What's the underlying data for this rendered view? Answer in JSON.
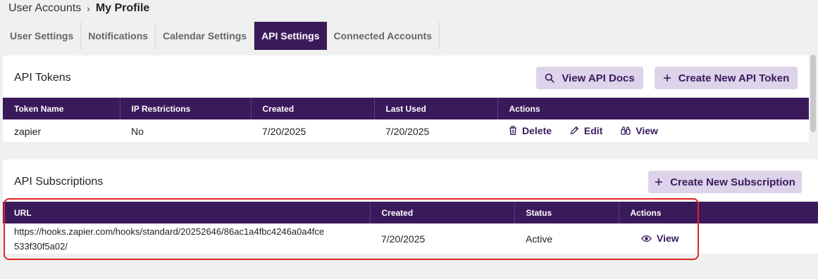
{
  "breadcrumb": {
    "parent": "User Accounts",
    "separator": "›",
    "current": "My Profile"
  },
  "tabs": [
    {
      "label": "User Settings"
    },
    {
      "label": "Notifications"
    },
    {
      "label": "Calendar Settings"
    },
    {
      "label": "API Settings",
      "active": true
    },
    {
      "label": "Connected Accounts"
    }
  ],
  "tokens": {
    "title": "API Tokens",
    "view_docs_label": "View API Docs",
    "create_label": "Create New API Token",
    "columns": [
      "Token Name",
      "IP Restrictions",
      "Created",
      "Last Used",
      "Actions"
    ],
    "rows": [
      {
        "name": "zapier",
        "ip": "No",
        "created": "7/20/2025",
        "last_used": "7/20/2025",
        "actions": {
          "delete": "Delete",
          "edit": "Edit",
          "view": "View"
        }
      }
    ]
  },
  "subscriptions": {
    "title": "API Subscriptions",
    "create_label": "Create New Subscription",
    "columns": [
      "URL",
      "Created",
      "Status",
      "Actions"
    ],
    "rows": [
      {
        "url_line1": "https://hooks.zapier.com/hooks/standard/20252646/86ac1a4fbc4246a0a4fce",
        "url_line2": "533f30f5a02/",
        "created": "7/20/2025",
        "status": "Active",
        "view": "View"
      }
    ]
  },
  "colors": {
    "primary": "#3b1a5c",
    "button_bg": "#ddd3ea",
    "highlight": "#e02424"
  }
}
